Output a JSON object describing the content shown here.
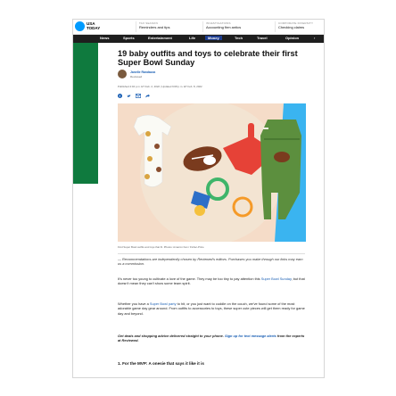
{
  "brand": {
    "logo_text": "USA TODAY"
  },
  "promos": [
    {
      "kicker": "TAX SEASON",
      "title": "Reminders and tips"
    },
    {
      "kicker": "INVESTIGATIONS",
      "title": "Accounting firm antics"
    },
    {
      "kicker": "CORPORATE DIVERSITY",
      "title": "Checking claims"
    }
  ],
  "nav": {
    "items": [
      "News",
      "Sports",
      "Entertainment",
      "Life",
      "Money",
      "Tech",
      "Travel",
      "Opinion"
    ],
    "active": "Money"
  },
  "article": {
    "headline": "19 baby outfits and toys to celebrate their first Super Bowl Sunday",
    "author": "Janelle Randazza",
    "outlet": "Reviewed",
    "dates": "Published 4:04 p.m. ET Feb. 2, 2022 | Updated 9:08 p.m. ET Feb. 8, 2022",
    "share_icons": [
      "facebook-icon",
      "twitter-icon",
      "email-icon",
      "share-icon"
    ],
    "image_caption": "Find Super Bowl outfits and toys that fit. Photos: Amazon Fan / Fisher-Price",
    "disclaimer": "— Recommendations are independently chosen by Reviewed's editors. Purchases you make through our links may earn us a commission.",
    "para1_a": "It's never too young to cultivate a love of the game. They may be too tiny to pay attention this ",
    "para1_link": "Super Bowl Sunday",
    "para1_b": ", but that doesn't mean they can't show some team spirit.",
    "para2_a": "Whether you have a ",
    "para2_link": "Super Bowl party",
    "para2_b": " to hit, or you just want to cuddle on the couch, we've found some of the most adorable game day gear around. From outfits to accessories to toys, these super cute pieces will get them ready for game day and beyond.",
    "newsletter_a": "Get deals and shopping advice delivered straight to your phone. ",
    "newsletter_link": "Sign up for text message alerts",
    "newsletter_b": " from the experts at Reviewed.",
    "section1": "1. For the MVP: A onesie that says it like it is"
  },
  "colors": {
    "brand_blue": "#009bff",
    "nav_dark": "#1e1e1e",
    "money_badge": "#1e3d8f",
    "side_green": "#0f7a3e",
    "link_blue": "#1a5fb4"
  }
}
